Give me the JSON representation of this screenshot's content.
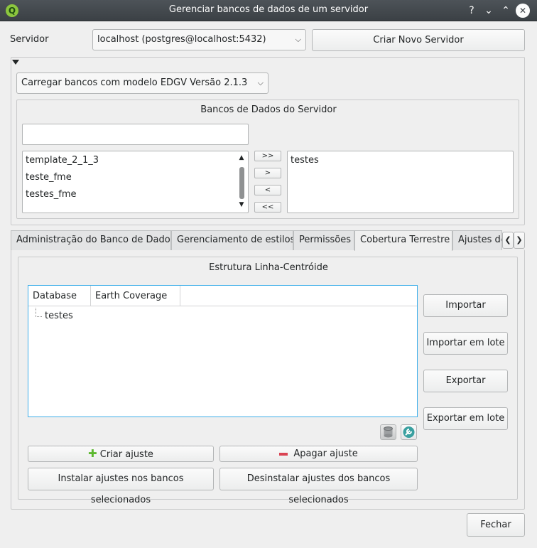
{
  "window": {
    "title": "Gerenciar bancos de dados de um servidor",
    "logo_letter": "Q",
    "help_glyph": "?",
    "minimize_glyph": "⌄",
    "maximize_glyph": "⌃",
    "close_glyph": "✕"
  },
  "server": {
    "label": "Servidor",
    "selected": "localhost (postgres@localhost:5432)",
    "create_button": "Criar Novo Servidor"
  },
  "model_combo": {
    "selected": "Carregar bancos com modelo EDGV Versão 2.1.3"
  },
  "server_dbs": {
    "title": "Bancos de Dados do Servidor",
    "filter_value": "",
    "available": [
      "template_2_1_3",
      "teste_fme",
      "testes_fme"
    ],
    "selected": [
      "testes"
    ],
    "move_all_right": ">>",
    "move_right": ">",
    "move_left": "<",
    "move_all_left": "<<"
  },
  "tabs": [
    {
      "label": "Administração do Banco de Dados"
    },
    {
      "label": "Gerenciamento de estilos"
    },
    {
      "label": "Permissões"
    },
    {
      "label": "Cobertura Terrestre"
    },
    {
      "label": "Ajustes de B"
    }
  ],
  "active_tab": "Cobertura Terrestre",
  "coverage": {
    "title": "Estrutura Linha-Centróide",
    "columns": [
      "Database",
      "Earth Coverage"
    ],
    "rows": [
      "testes"
    ],
    "import": "Importar",
    "batch_import": "Importar em lote",
    "export": "Exportar",
    "batch_export": "Exportar em lote",
    "create_setting": "Criar ajuste",
    "delete_setting": "Apagar ajuste",
    "install_settings": "Instalar ajustes nos bancos selecionados",
    "uninstall_settings": "Desinstalar ajustes dos bancos selecionados"
  },
  "close_button": "Fechar",
  "colors": {
    "titlebar": "#3b4045",
    "focus_border": "#3daee9",
    "add_green": "#5cb82f",
    "delete_red": "#da4453"
  }
}
